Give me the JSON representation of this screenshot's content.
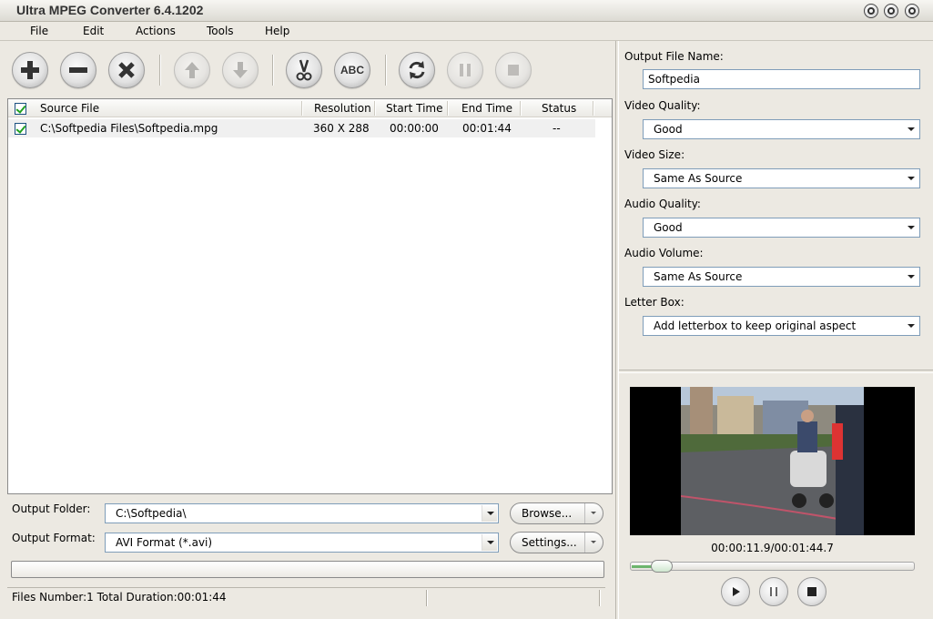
{
  "window": {
    "title": "Ultra MPEG Converter 6.4.1202"
  },
  "menu": [
    "File",
    "Edit",
    "Actions",
    "Tools",
    "Help"
  ],
  "toolbar": {
    "convert_label": "ABC"
  },
  "file_list": {
    "columns": [
      "Source File",
      "Resolution",
      "Start Time",
      "End Time",
      "Status"
    ],
    "rows": [
      {
        "checked": true,
        "source": "C:\\Softpedia Files\\Softpedia.mpg",
        "resolution": "360 X 288",
        "start": "00:00:00",
        "end": "00:01:44",
        "status": "--"
      }
    ]
  },
  "output": {
    "folder_label": "Output Folder:",
    "folder_value": "C:\\Softpedia\\",
    "format_label": "Output Format:",
    "format_value": "AVI Format (*.avi)",
    "browse_label": "Browse...",
    "settings_label": "Settings..."
  },
  "status": {
    "text": "Files Number:1   Total Duration:00:01:44"
  },
  "settings": {
    "output_name_label": "Output File Name:",
    "output_name_value": "Softpedia",
    "video_quality_label": "Video Quality:",
    "video_quality_value": "Good",
    "video_size_label": "Video Size:",
    "video_size_value": "Same As Source",
    "audio_quality_label": "Audio Quality:",
    "audio_quality_value": "Good",
    "audio_volume_label": "Audio Volume:",
    "audio_volume_value": "Same As Source",
    "letter_box_label": "Letter Box:",
    "letter_box_value": "Add letterbox to keep original aspect"
  },
  "preview": {
    "time": "00:00:11.9/00:01:44.7",
    "progress": 0.11
  },
  "colors": {
    "accent_check": "#21a121",
    "slider_fill": "#6db56d"
  }
}
